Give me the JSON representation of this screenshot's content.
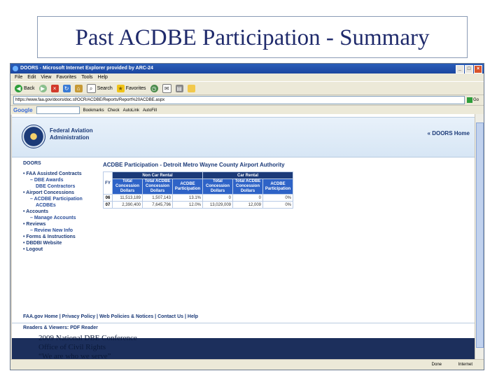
{
  "slide": {
    "title": "Past ACDBE Participation - Summary"
  },
  "browser": {
    "title": "DOORS - Microsoft Internet Explorer provided by ARC-24",
    "menu": [
      "File",
      "Edit",
      "View",
      "Favorites",
      "Tools",
      "Help"
    ],
    "toolbar": {
      "back": "Back",
      "search": "Search",
      "favorites": "Favorites"
    },
    "address": "https://www.faa.gov/doors/doc.sf/OCR/ACDBE/Reports/Report%20ACDBE.aspx",
    "go": "Go",
    "google": {
      "logo": "Google",
      "items": [
        "Bookmarks",
        "Check",
        "AutoLink",
        "AutoFill"
      ]
    },
    "status": {
      "done": "Done",
      "zone": "Internet"
    }
  },
  "page": {
    "agency": "Federal Aviation Administration",
    "doors_home": "« DOORS Home",
    "nav_title": "DOORS",
    "nav": [
      {
        "label": "FAA Assisted Contracts",
        "level": 1
      },
      {
        "label": "DBE Awards",
        "level": 2
      },
      {
        "label": "DBE Contractors",
        "level": 3
      },
      {
        "label": "Airport Concessions",
        "level": 1
      },
      {
        "label": "ACDBE Participation",
        "level": 2
      },
      {
        "label": "ACDBEs",
        "level": 3
      },
      {
        "label": "Accounts",
        "level": 1
      },
      {
        "label": "Manage Accounts",
        "level": 2
      },
      {
        "label": "Reviews",
        "level": 1
      },
      {
        "label": "Review New Info",
        "level": 2
      },
      {
        "label": "Forms & Instructions",
        "level": 1
      },
      {
        "label": "DBDBI Website",
        "level": 1
      },
      {
        "label": "Logout",
        "level": 1
      }
    ],
    "main_title": "ACDBE Participation - Detroit Metro Wayne County Airport Authority",
    "table": {
      "group_non_car": "Non Car Rental",
      "group_car": "Car Rental",
      "fy_label": "FY",
      "columns": [
        "Total Concession Dollars",
        "Total ACDBE Concession Dollars",
        "ACDBE Participation",
        "Total Concession Dollars",
        "Total ACDBE Concession Dollars",
        "ACDBE Participation"
      ],
      "rows": [
        {
          "fy": "06",
          "cells": [
            "11,513,189",
            "1,507,143",
            "13.1%",
            "0",
            "0",
            "0%"
          ]
        },
        {
          "fy": "07",
          "cells": [
            "2,390,400",
            "7,645,796",
            "12.0%",
            "13,029,009",
            "12,009",
            "0%"
          ]
        }
      ]
    },
    "footer_links": "FAA.gov Home | Privacy Policy | Web Policies & Notices | Contact Us | Help",
    "footer_readers": "Readers & Viewers: PDF Reader"
  },
  "footer": {
    "line1": "2009 National DBE Conference",
    "line2": "Office of Civil Rights",
    "line3": "“We are who we serve”"
  }
}
